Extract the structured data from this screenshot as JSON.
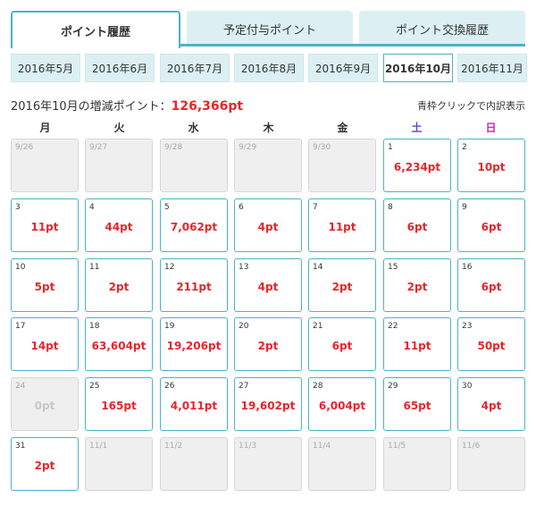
{
  "tabs": [
    {
      "label": "ポイント履歴",
      "active": true
    },
    {
      "label": "予定付与ポイント",
      "active": false
    },
    {
      "label": "ポイント交換履歴",
      "active": false
    }
  ],
  "months": [
    "2016年5月",
    "2016年6月",
    "2016年7月",
    "2016年8月",
    "2016年9月",
    "2016年10月",
    "2016年11月"
  ],
  "active_month_index": 5,
  "summary": {
    "label": "2016年10月の増減ポイント：",
    "total": "126,366pt"
  },
  "hint": "青枠クリックで内訳表示",
  "weekdays": [
    "月",
    "火",
    "水",
    "木",
    "金",
    "土",
    "日"
  ],
  "days": [
    {
      "day": "9/26",
      "pts": "",
      "state": "muted"
    },
    {
      "day": "9/27",
      "pts": "",
      "state": "muted"
    },
    {
      "day": "9/28",
      "pts": "",
      "state": "muted"
    },
    {
      "day": "9/29",
      "pts": "",
      "state": "muted"
    },
    {
      "day": "9/30",
      "pts": "",
      "state": "muted"
    },
    {
      "day": "1",
      "pts": "6,234pt",
      "state": "active"
    },
    {
      "day": "2",
      "pts": "10pt",
      "state": "active"
    },
    {
      "day": "3",
      "pts": "11pt",
      "state": "active"
    },
    {
      "day": "4",
      "pts": "44pt",
      "state": "active"
    },
    {
      "day": "5",
      "pts": "7,062pt",
      "state": "active"
    },
    {
      "day": "6",
      "pts": "4pt",
      "state": "active"
    },
    {
      "day": "7",
      "pts": "11pt",
      "state": "active"
    },
    {
      "day": "8",
      "pts": "6pt",
      "state": "active"
    },
    {
      "day": "9",
      "pts": "6pt",
      "state": "active"
    },
    {
      "day": "10",
      "pts": "5pt",
      "state": "active"
    },
    {
      "day": "11",
      "pts": "2pt",
      "state": "active"
    },
    {
      "day": "12",
      "pts": "211pt",
      "state": "active"
    },
    {
      "day": "13",
      "pts": "4pt",
      "state": "active"
    },
    {
      "day": "14",
      "pts": "2pt",
      "state": "active"
    },
    {
      "day": "15",
      "pts": "2pt",
      "state": "active"
    },
    {
      "day": "16",
      "pts": "6pt",
      "state": "active"
    },
    {
      "day": "17",
      "pts": "14pt",
      "state": "active"
    },
    {
      "day": "18",
      "pts": "63,604pt",
      "state": "active"
    },
    {
      "day": "19",
      "pts": "19,206pt",
      "state": "active"
    },
    {
      "day": "20",
      "pts": "2pt",
      "state": "active"
    },
    {
      "day": "21",
      "pts": "6pt",
      "state": "active"
    },
    {
      "day": "22",
      "pts": "11pt",
      "state": "active"
    },
    {
      "day": "23",
      "pts": "50pt",
      "state": "active"
    },
    {
      "day": "24",
      "pts": "0pt",
      "state": "zero"
    },
    {
      "day": "25",
      "pts": "165pt",
      "state": "active"
    },
    {
      "day": "26",
      "pts": "4,011pt",
      "state": "active"
    },
    {
      "day": "27",
      "pts": "19,602pt",
      "state": "active"
    },
    {
      "day": "28",
      "pts": "6,004pt",
      "state": "active"
    },
    {
      "day": "29",
      "pts": "65pt",
      "state": "active"
    },
    {
      "day": "30",
      "pts": "4pt",
      "state": "active"
    },
    {
      "day": "31",
      "pts": "2pt",
      "state": "active"
    },
    {
      "day": "11/1",
      "pts": "",
      "state": "muted"
    },
    {
      "day": "11/2",
      "pts": "",
      "state": "muted"
    },
    {
      "day": "11/3",
      "pts": "",
      "state": "muted"
    },
    {
      "day": "11/4",
      "pts": "",
      "state": "muted"
    },
    {
      "day": "11/5",
      "pts": "",
      "state": "muted"
    },
    {
      "day": "11/6",
      "pts": "",
      "state": "muted"
    }
  ],
  "colors": {
    "accent": "#4bb3c6",
    "points": "#e8252c",
    "saturday": "#6b3fd1",
    "sunday": "#d126a6"
  }
}
